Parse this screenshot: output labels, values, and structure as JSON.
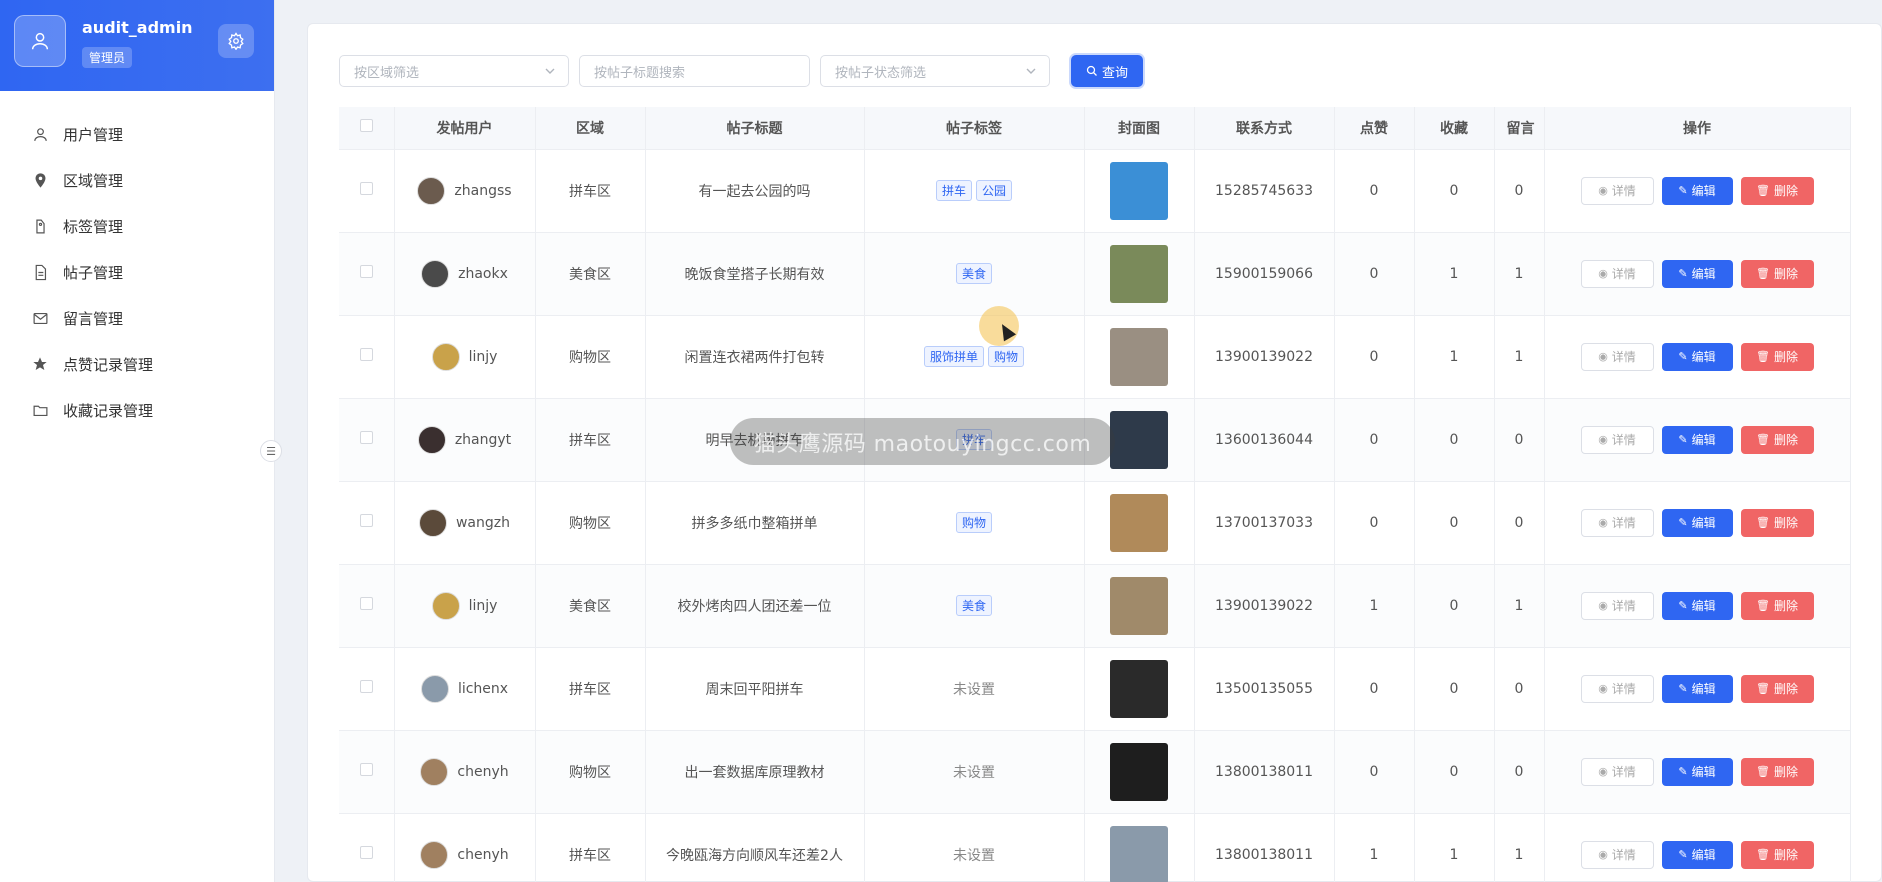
{
  "user": {
    "name": "audit_admin",
    "role": "管理员"
  },
  "menu": [
    {
      "label": "用户管理",
      "icon": "user-icon"
    },
    {
      "label": "区域管理",
      "icon": "location-icon"
    },
    {
      "label": "标签管理",
      "icon": "tag-icon"
    },
    {
      "label": "帖子管理",
      "icon": "document-icon"
    },
    {
      "label": "留言管理",
      "icon": "mail-icon"
    },
    {
      "label": "点赞记录管理",
      "icon": "star-icon"
    },
    {
      "label": "收藏记录管理",
      "icon": "folder-icon"
    }
  ],
  "filters": {
    "region_placeholder": "按区域筛选",
    "title_placeholder": "按帖子标题搜索",
    "status_placeholder": "按帖子状态筛选",
    "query_label": "查询"
  },
  "table": {
    "headers": [
      "发帖用户",
      "区域",
      "帖子标题",
      "帖子标签",
      "封面图",
      "联系方式",
      "点赞",
      "收藏",
      "留言",
      "操作"
    ],
    "actions": {
      "detail": "详情",
      "edit": "编辑",
      "delete": "删除"
    },
    "rows": [
      {
        "user": "zhangss",
        "region": "拼车区",
        "title": "有一起去公园的吗",
        "tags": [
          "拼车",
          "公园"
        ],
        "phone": "15285745633",
        "likes": "0",
        "favs": "0",
        "comments": "0",
        "avatar_color": "#6b5b4e",
        "cover_color": "#3b8fd6"
      },
      {
        "user": "zhaokx",
        "region": "美食区",
        "title": "晚饭食堂搭子长期有效",
        "tags": [
          "美食"
        ],
        "phone": "15900159066",
        "likes": "0",
        "favs": "1",
        "comments": "1",
        "avatar_color": "#4a4a4a",
        "cover_color": "#7a8a5a"
      },
      {
        "user": "linjy",
        "region": "购物区",
        "title": "闲置连衣裙两件打包转",
        "tags": [
          "服饰拼单",
          "购物"
        ],
        "phone": "13900139022",
        "likes": "0",
        "favs": "1",
        "comments": "1",
        "avatar_color": "#c9a24a",
        "cover_color": "#9a8f82"
      },
      {
        "user": "zhangyt",
        "region": "拼车区",
        "title": "明早去机场拼车",
        "tags": [
          "拼车"
        ],
        "phone": "13600136044",
        "likes": "0",
        "favs": "0",
        "comments": "0",
        "avatar_color": "#3a2f2f",
        "cover_color": "#2e3a4a"
      },
      {
        "user": "wangzh",
        "region": "购物区",
        "title": "拼多多纸巾整箱拼单",
        "tags": [
          "购物"
        ],
        "phone": "13700137033",
        "likes": "0",
        "favs": "0",
        "comments": "0",
        "avatar_color": "#5b4a3a",
        "cover_color": "#b08a5a"
      },
      {
        "user": "linjy",
        "region": "美食区",
        "title": "校外烤肉四人团还差一位",
        "tags": [
          "美食"
        ],
        "phone": "13900139022",
        "likes": "1",
        "favs": "0",
        "comments": "1",
        "avatar_color": "#c9a24a",
        "cover_color": "#a08a6a"
      },
      {
        "user": "lichenx",
        "region": "拼车区",
        "title": "周末回平阳拼车",
        "tags": [],
        "unset_label": "未设置",
        "phone": "13500135055",
        "likes": "0",
        "favs": "0",
        "comments": "0",
        "avatar_color": "#8a9aaa",
        "cover_color": "#2a2a2a"
      },
      {
        "user": "chenyh",
        "region": "购物区",
        "title": "出一套数据库原理教材",
        "tags": [],
        "unset_label": "未设置",
        "phone": "13800138011",
        "likes": "0",
        "favs": "0",
        "comments": "0",
        "avatar_color": "#a08060",
        "cover_color": "#1e1e1e"
      },
      {
        "user": "chenyh",
        "region": "拼车区",
        "title": "今晚瓯海方向顺风车还差2人",
        "tags": [],
        "unset_label": "未设置",
        "phone": "13800138011",
        "likes": "1",
        "favs": "1",
        "comments": "1",
        "avatar_color": "#a08060",
        "cover_color": "#8a9aaa"
      }
    ]
  },
  "watermark": "猫头鹰源码 maotouyingcc.com",
  "colors": {
    "primary": "#2f66f2",
    "danger": "#f06565",
    "tag_bg": "#eef3ff"
  }
}
